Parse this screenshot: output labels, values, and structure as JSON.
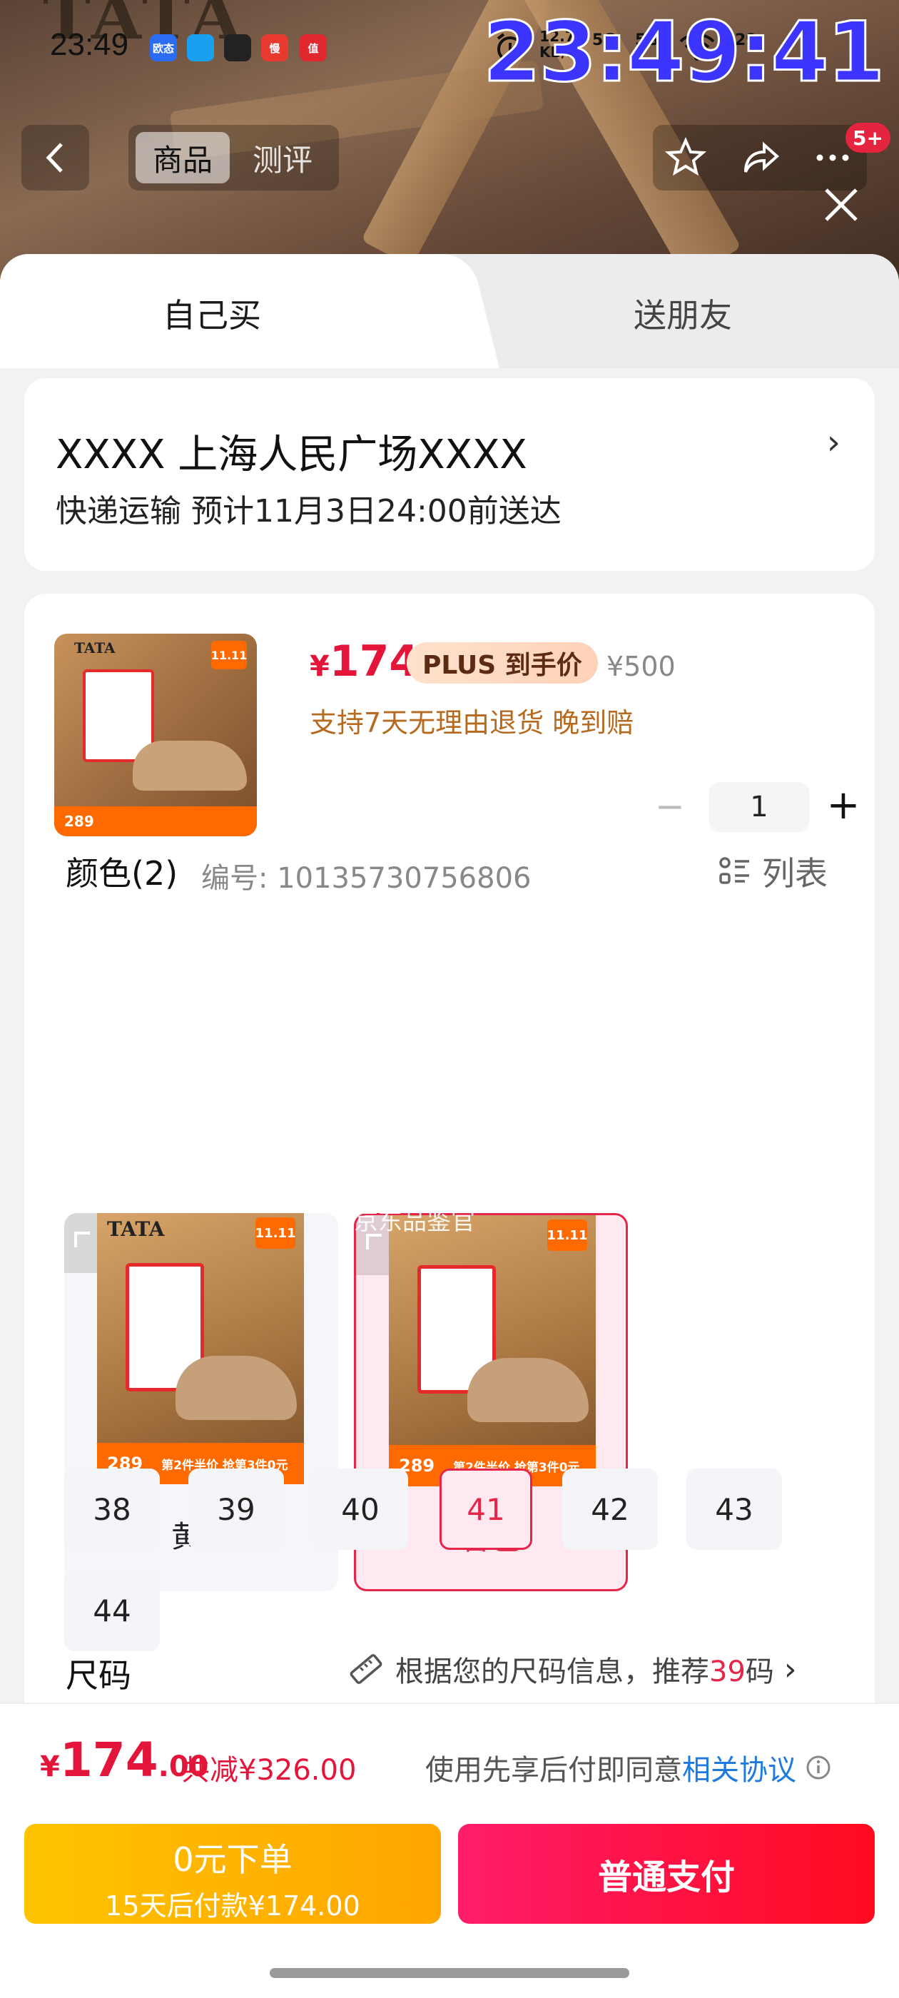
{
  "status_bar": {
    "time": "23:49",
    "net_speed_value": "12.7",
    "net_speed_unit": "KB/s",
    "signal_1": "5G",
    "signal_2": "5G",
    "battery": "29",
    "clock_overlay": "23:49:41",
    "app_icons": [
      {
        "name": "app-icon-oushi",
        "label": "欧态",
        "color": "#2b6cf2"
      },
      {
        "name": "app-icon-blue",
        "label": "",
        "color": "#1aa0f0"
      },
      {
        "name": "app-icon-qq",
        "label": "",
        "color": "#222222"
      },
      {
        "name": "app-icon-man",
        "label": "慢",
        "color": "#e83a2e"
      },
      {
        "name": "app-icon-zhi",
        "label": "值",
        "color": "#e0282e"
      }
    ]
  },
  "backdrop": {
    "brand": "TATA"
  },
  "nav": {
    "tabs": [
      {
        "label": "商品",
        "active": true
      },
      {
        "label": "测评",
        "active": false
      }
    ],
    "more_badge": "5+"
  },
  "sheet": {
    "tabs": {
      "self": "自己买",
      "gift": "送朋友"
    },
    "address": {
      "line": "XXXX  上海人民广场XXXX",
      "delivery": "快递运输  预计11月3日24:00前送达"
    },
    "product": {
      "currency": "¥",
      "price": "174",
      "plus_label": "PLUS 到手价",
      "orig_price": "¥500",
      "promises": "支持7天无理由退货  晚到赔",
      "quantity": "1",
      "thumb_brand": "TATA",
      "thumb_tag": "11.11",
      "thumb_banner": "289"
    },
    "color": {
      "title": "颜色(2)",
      "code": "编号: 10135730756806",
      "list_label": "列表",
      "watermark": "京东品鉴官",
      "options": [
        {
          "label": "黄棕",
          "selected": false,
          "banner": "289",
          "promo": "第2件半价 抢第3件0元",
          "tag": "11.11",
          "brand": "TATA"
        },
        {
          "label": "杏色",
          "selected": true,
          "banner": "289",
          "promo": "第2件半价 抢第3件0元",
          "tag": "11.11",
          "brand": ""
        }
      ]
    },
    "size": {
      "title": "尺码",
      "hint_prefix": "根据您的尺码信息，推荐",
      "hint_value": "39",
      "hint_suffix": "码",
      "options": [
        {
          "label": "38",
          "selected": false
        },
        {
          "label": "39",
          "selected": false
        },
        {
          "label": "40",
          "selected": false
        },
        {
          "label": "41",
          "selected": true
        },
        {
          "label": "42",
          "selected": false
        },
        {
          "label": "43",
          "selected": false
        },
        {
          "label": "44",
          "selected": false
        }
      ]
    }
  },
  "pay_bar": {
    "currency": "¥",
    "total_int": "174",
    "total_dec": ".00",
    "saved": "共减¥326.00",
    "agree_prefix": "使用先享后付即同意",
    "agree_link": "相关协议",
    "later_line1": "0元下单",
    "later_line2": "15天后付款¥174.00",
    "pay_label": "普通支付"
  },
  "colors": {
    "accent": "#e5254a",
    "price": "#e4153a",
    "link": "#1f7ae0",
    "later": "#ffb400"
  }
}
